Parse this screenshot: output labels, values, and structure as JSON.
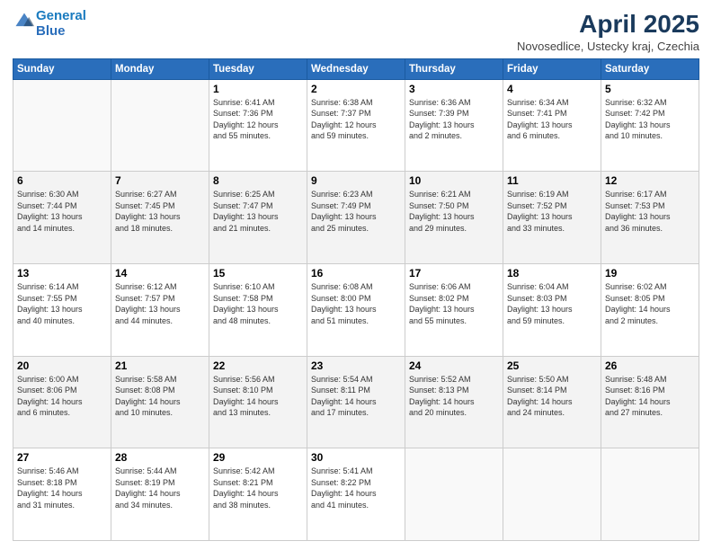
{
  "header": {
    "logo_line1": "General",
    "logo_line2": "Blue",
    "month": "April 2025",
    "location": "Novosedlice, Ustecky kraj, Czechia"
  },
  "days_of_week": [
    "Sunday",
    "Monday",
    "Tuesday",
    "Wednesday",
    "Thursday",
    "Friday",
    "Saturday"
  ],
  "weeks": [
    [
      {
        "day": "",
        "lines": []
      },
      {
        "day": "",
        "lines": []
      },
      {
        "day": "1",
        "lines": [
          "Sunrise: 6:41 AM",
          "Sunset: 7:36 PM",
          "Daylight: 12 hours",
          "and 55 minutes."
        ]
      },
      {
        "day": "2",
        "lines": [
          "Sunrise: 6:38 AM",
          "Sunset: 7:37 PM",
          "Daylight: 12 hours",
          "and 59 minutes."
        ]
      },
      {
        "day": "3",
        "lines": [
          "Sunrise: 6:36 AM",
          "Sunset: 7:39 PM",
          "Daylight: 13 hours",
          "and 2 minutes."
        ]
      },
      {
        "day": "4",
        "lines": [
          "Sunrise: 6:34 AM",
          "Sunset: 7:41 PM",
          "Daylight: 13 hours",
          "and 6 minutes."
        ]
      },
      {
        "day": "5",
        "lines": [
          "Sunrise: 6:32 AM",
          "Sunset: 7:42 PM",
          "Daylight: 13 hours",
          "and 10 minutes."
        ]
      }
    ],
    [
      {
        "day": "6",
        "lines": [
          "Sunrise: 6:30 AM",
          "Sunset: 7:44 PM",
          "Daylight: 13 hours",
          "and 14 minutes."
        ]
      },
      {
        "day": "7",
        "lines": [
          "Sunrise: 6:27 AM",
          "Sunset: 7:45 PM",
          "Daylight: 13 hours",
          "and 18 minutes."
        ]
      },
      {
        "day": "8",
        "lines": [
          "Sunrise: 6:25 AM",
          "Sunset: 7:47 PM",
          "Daylight: 13 hours",
          "and 21 minutes."
        ]
      },
      {
        "day": "9",
        "lines": [
          "Sunrise: 6:23 AM",
          "Sunset: 7:49 PM",
          "Daylight: 13 hours",
          "and 25 minutes."
        ]
      },
      {
        "day": "10",
        "lines": [
          "Sunrise: 6:21 AM",
          "Sunset: 7:50 PM",
          "Daylight: 13 hours",
          "and 29 minutes."
        ]
      },
      {
        "day": "11",
        "lines": [
          "Sunrise: 6:19 AM",
          "Sunset: 7:52 PM",
          "Daylight: 13 hours",
          "and 33 minutes."
        ]
      },
      {
        "day": "12",
        "lines": [
          "Sunrise: 6:17 AM",
          "Sunset: 7:53 PM",
          "Daylight: 13 hours",
          "and 36 minutes."
        ]
      }
    ],
    [
      {
        "day": "13",
        "lines": [
          "Sunrise: 6:14 AM",
          "Sunset: 7:55 PM",
          "Daylight: 13 hours",
          "and 40 minutes."
        ]
      },
      {
        "day": "14",
        "lines": [
          "Sunrise: 6:12 AM",
          "Sunset: 7:57 PM",
          "Daylight: 13 hours",
          "and 44 minutes."
        ]
      },
      {
        "day": "15",
        "lines": [
          "Sunrise: 6:10 AM",
          "Sunset: 7:58 PM",
          "Daylight: 13 hours",
          "and 48 minutes."
        ]
      },
      {
        "day": "16",
        "lines": [
          "Sunrise: 6:08 AM",
          "Sunset: 8:00 PM",
          "Daylight: 13 hours",
          "and 51 minutes."
        ]
      },
      {
        "day": "17",
        "lines": [
          "Sunrise: 6:06 AM",
          "Sunset: 8:02 PM",
          "Daylight: 13 hours",
          "and 55 minutes."
        ]
      },
      {
        "day": "18",
        "lines": [
          "Sunrise: 6:04 AM",
          "Sunset: 8:03 PM",
          "Daylight: 13 hours",
          "and 59 minutes."
        ]
      },
      {
        "day": "19",
        "lines": [
          "Sunrise: 6:02 AM",
          "Sunset: 8:05 PM",
          "Daylight: 14 hours",
          "and 2 minutes."
        ]
      }
    ],
    [
      {
        "day": "20",
        "lines": [
          "Sunrise: 6:00 AM",
          "Sunset: 8:06 PM",
          "Daylight: 14 hours",
          "and 6 minutes."
        ]
      },
      {
        "day": "21",
        "lines": [
          "Sunrise: 5:58 AM",
          "Sunset: 8:08 PM",
          "Daylight: 14 hours",
          "and 10 minutes."
        ]
      },
      {
        "day": "22",
        "lines": [
          "Sunrise: 5:56 AM",
          "Sunset: 8:10 PM",
          "Daylight: 14 hours",
          "and 13 minutes."
        ]
      },
      {
        "day": "23",
        "lines": [
          "Sunrise: 5:54 AM",
          "Sunset: 8:11 PM",
          "Daylight: 14 hours",
          "and 17 minutes."
        ]
      },
      {
        "day": "24",
        "lines": [
          "Sunrise: 5:52 AM",
          "Sunset: 8:13 PM",
          "Daylight: 14 hours",
          "and 20 minutes."
        ]
      },
      {
        "day": "25",
        "lines": [
          "Sunrise: 5:50 AM",
          "Sunset: 8:14 PM",
          "Daylight: 14 hours",
          "and 24 minutes."
        ]
      },
      {
        "day": "26",
        "lines": [
          "Sunrise: 5:48 AM",
          "Sunset: 8:16 PM",
          "Daylight: 14 hours",
          "and 27 minutes."
        ]
      }
    ],
    [
      {
        "day": "27",
        "lines": [
          "Sunrise: 5:46 AM",
          "Sunset: 8:18 PM",
          "Daylight: 14 hours",
          "and 31 minutes."
        ]
      },
      {
        "day": "28",
        "lines": [
          "Sunrise: 5:44 AM",
          "Sunset: 8:19 PM",
          "Daylight: 14 hours",
          "and 34 minutes."
        ]
      },
      {
        "day": "29",
        "lines": [
          "Sunrise: 5:42 AM",
          "Sunset: 8:21 PM",
          "Daylight: 14 hours",
          "and 38 minutes."
        ]
      },
      {
        "day": "30",
        "lines": [
          "Sunrise: 5:41 AM",
          "Sunset: 8:22 PM",
          "Daylight: 14 hours",
          "and 41 minutes."
        ]
      },
      {
        "day": "",
        "lines": []
      },
      {
        "day": "",
        "lines": []
      },
      {
        "day": "",
        "lines": []
      }
    ]
  ]
}
